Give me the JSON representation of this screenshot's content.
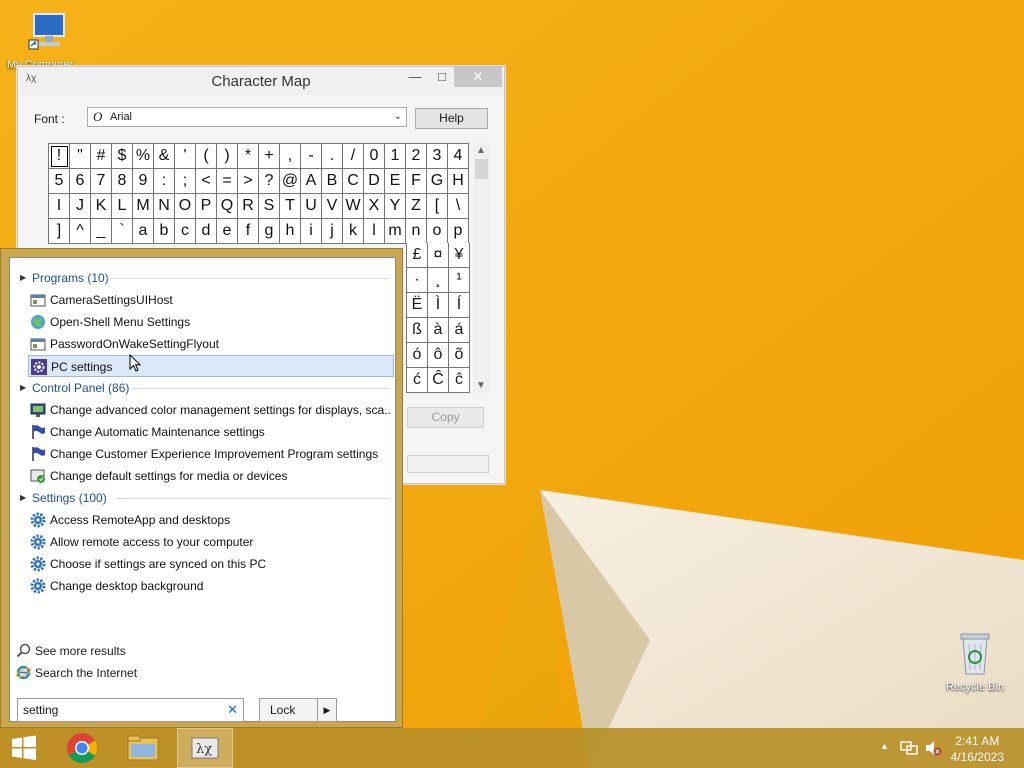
{
  "desktop": {
    "icons": [
      {
        "label": "My Computer"
      },
      {
        "label": "Recycle Bin"
      }
    ]
  },
  "charmap": {
    "title": "Character Map",
    "font_label": "Font :",
    "font_value": "Arial",
    "help_label": "Help",
    "copy_label": "Copy",
    "chars": [
      "!",
      "\"",
      "#",
      "$",
      "%",
      "&",
      "'",
      "(",
      ")",
      "*",
      "+",
      ",",
      "-",
      ".",
      "/",
      "0",
      "1",
      "2",
      "3",
      "4",
      "5",
      "6",
      "7",
      "8",
      "9",
      ":",
      ";",
      "<",
      "=",
      ">",
      "?",
      "@",
      "A",
      "B",
      "C",
      "D",
      "E",
      "F",
      "G",
      "H",
      "I",
      "J",
      "K",
      "L",
      "M",
      "N",
      "O",
      "P",
      "Q",
      "R",
      "S",
      "T",
      "U",
      "V",
      "W",
      "X",
      "Y",
      "Z",
      "[",
      "\\",
      "]",
      "^",
      "_",
      "`",
      "a",
      "b",
      "c",
      "d",
      "e",
      "f",
      "g",
      "h",
      "i",
      "j",
      "k",
      "l",
      "m",
      "n",
      "o",
      "p"
    ],
    "peek_rows": [
      [
        "£",
        "¤",
        "¥"
      ],
      [
        "·",
        "¸",
        "¹"
      ],
      [
        "Ë",
        "Ì",
        "Í"
      ],
      [
        "ß",
        "à",
        "á"
      ],
      [
        "ó",
        "ô",
        "õ"
      ],
      [
        "ć",
        "Ĉ",
        "ĉ"
      ]
    ]
  },
  "startmenu": {
    "sections": [
      {
        "heading": "Programs (10)",
        "items": [
          {
            "label": "CameraSettingsUIHost",
            "icon": "window-app-icon"
          },
          {
            "label": "Open-Shell Menu Settings",
            "icon": "shell-globe-icon"
          },
          {
            "label": "PasswordOnWakeSettingFlyout",
            "icon": "window-app-icon"
          },
          {
            "label": "PC settings",
            "icon": "gear-icon",
            "highlighted": true
          }
        ]
      },
      {
        "heading": "Control Panel (86)",
        "items": [
          {
            "label": "Change advanced color management settings for displays, sca...",
            "icon": "monitor-icon"
          },
          {
            "label": "Change Automatic Maintenance settings",
            "icon": "flag-icon"
          },
          {
            "label": "Change Customer Experience Improvement Program settings",
            "icon": "flag-icon"
          },
          {
            "label": "Change default settings for media or devices",
            "icon": "media-device-icon"
          }
        ]
      },
      {
        "heading": "Settings (100)",
        "items": [
          {
            "label": "Access RemoteApp and desktops",
            "icon": "gear-icon"
          },
          {
            "label": "Allow remote access to your computer",
            "icon": "gear-icon"
          },
          {
            "label": "Choose if settings are synced on this PC",
            "icon": "gear-icon"
          },
          {
            "label": "Change desktop background",
            "icon": "gear-icon"
          }
        ]
      }
    ],
    "see_more": "See more results",
    "search_internet": "Search the Internet",
    "search_value": "setting",
    "lock_label": "Lock"
  },
  "taskbar": {
    "time": "2:41 AM",
    "date": "4/16/2023"
  },
  "colors": {
    "wallpaper": "#f2a90c",
    "link_blue": "#1d4f91",
    "highlight": "#dbe8f8"
  }
}
